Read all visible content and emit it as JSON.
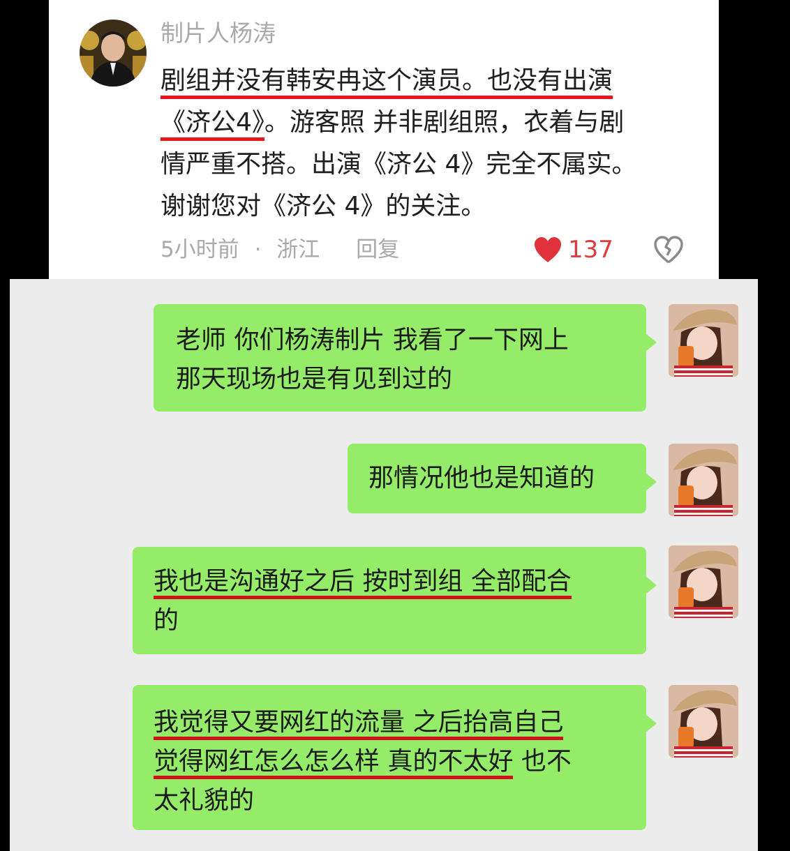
{
  "comment": {
    "author": "制片人杨涛",
    "lines": [
      [
        "剧组并没有韩安冉这个演员。也没有出演"
      ],
      [
        "《济公4》",
        "。游客照 并非剧组照，衣着与剧"
      ],
      [
        "情严重不搭。出演《济公 4》完全不属实。"
      ],
      [
        "谢谢您对《济公 4》的关注。"
      ]
    ],
    "time": "5小时前",
    "separator": "·",
    "location": "浙江",
    "reply_label": "回复",
    "like_count": "137",
    "like_color": "#e03a3f"
  },
  "chat": {
    "bubble_color": "#95ec69",
    "messages": [
      {
        "lines": [
          [
            "老师 你们杨涛制片 我看了一下网上"
          ],
          [
            "那天现场也是有见到过的"
          ]
        ]
      },
      {
        "lines": [
          [
            "那情况他也是知道的"
          ]
        ]
      },
      {
        "lines": [
          [
            "我也是沟通好之后 按时到组 全部配合"
          ],
          [
            "的"
          ]
        ]
      },
      {
        "lines": [
          [
            "我觉得又要网红的流量 之后抬高自己"
          ],
          [
            "觉得网红怎么怎么样 真的不太好",
            " 也不"
          ],
          [
            "太礼貌的"
          ]
        ]
      }
    ]
  },
  "icons": {
    "comment_avatar": "man-in-suit-avatar",
    "like": "heart-icon",
    "dislike": "broken-heart-icon",
    "chat_avatar": "woman-with-hat-avatar"
  }
}
